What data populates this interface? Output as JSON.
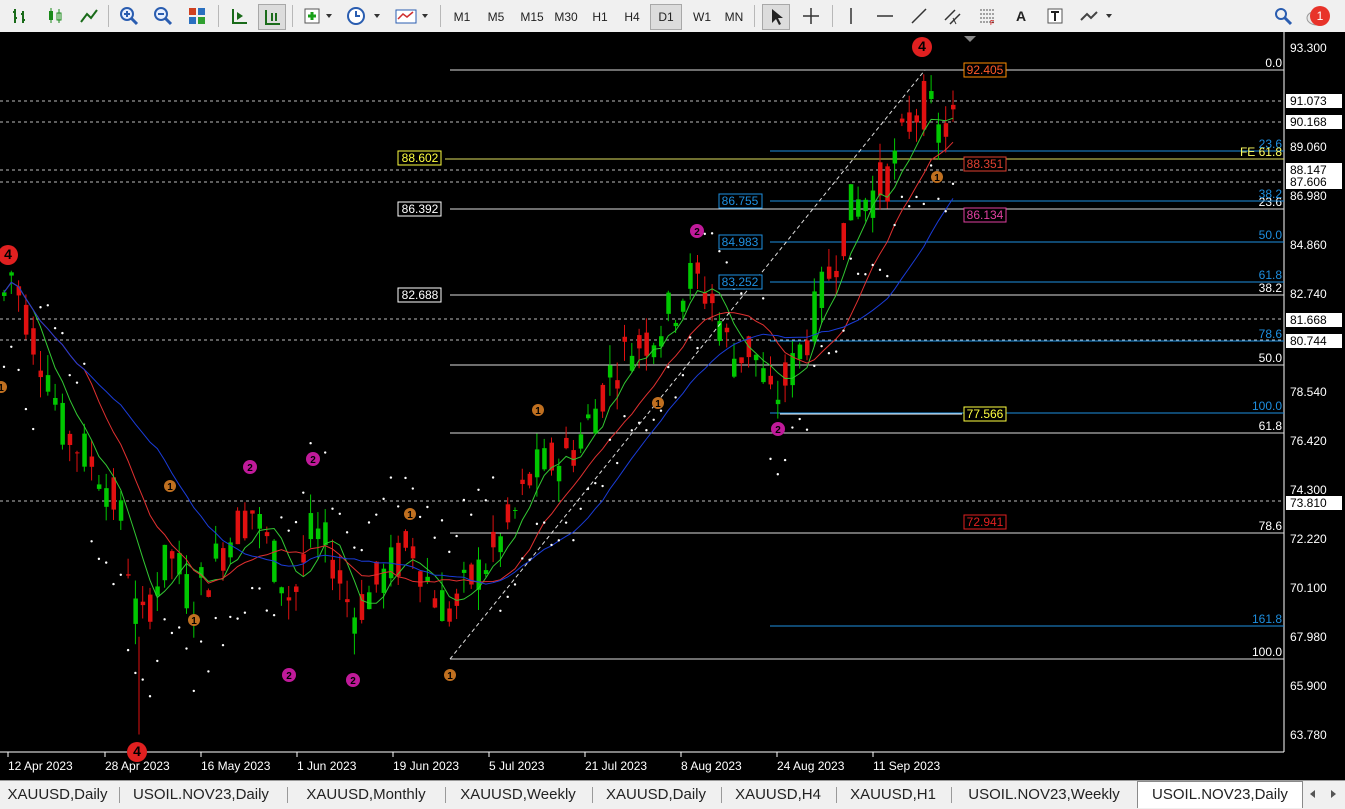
{
  "toolbar": {
    "timeframes": [
      "M1",
      "M5",
      "M15",
      "M30",
      "H1",
      "H4",
      "D1",
      "W1",
      "MN"
    ],
    "active_timeframe": "D1",
    "notification_count": "1",
    "text_tool_label": "A"
  },
  "chart": {
    "symbol": "USOIL.NOV23",
    "period": "Daily",
    "price_axis_labels": [
      "93.300",
      "92.405",
      "91.073",
      "90.168",
      "89.060",
      "88.147",
      "87.606",
      "86.980",
      "84.860",
      "82.740",
      "81.668",
      "80.744",
      "78.540",
      "76.420",
      "74.300",
      "73.810",
      "72.220",
      "70.100",
      "67.980",
      "65.900",
      "63.780"
    ],
    "date_axis_labels": [
      "12 Apr 2023",
      "28 Apr 2023",
      "16 May 2023",
      "1 Jun 2023",
      "19 Jun 2023",
      "5 Jul 2023",
      "21 Jul 2023",
      "8 Aug 2023",
      "24 Aug 2023",
      "11 Sep 2023"
    ],
    "left_level_tags": [
      "88.602",
      "86.392",
      "82.688"
    ],
    "right_level_tags": [
      "92.405",
      "88.351",
      "86.134",
      "72.941",
      "77.566"
    ],
    "blue_level_tags": [
      "86.755",
      "84.983",
      "83.252"
    ],
    "fibo_levels_white": [
      "0.0",
      "23.6",
      "38.2",
      "50.0",
      "61.8",
      "78.6",
      "100.0"
    ],
    "fibo_levels_blue": [
      "23.6",
      "38.2",
      "50.0",
      "61.8",
      "78.6",
      "100.0",
      "161.8"
    ],
    "fe_label": "FE 61.8",
    "wave_labels": [
      "4",
      "2",
      "2",
      "2",
      "2",
      "2",
      "2",
      "1",
      "1",
      "1",
      "1",
      "1",
      "1",
      "1",
      "4"
    ],
    "colors": {
      "bull": "#00c800",
      "bear": "#e01010",
      "ma_fast": "#32c832",
      "ma_mid": "#e03030",
      "ma_slow": "#1a3cd8",
      "fib_blue": "#1e8fe0",
      "tag_yellow": "#ffff40"
    }
  },
  "tabs": [
    {
      "label": "XAUUSD,Daily"
    },
    {
      "label": "USOIL.NOV23,Daily"
    },
    {
      "label": "XAUUSD,Monthly"
    },
    {
      "label": "XAUUSD,Weekly"
    },
    {
      "label": "XAUUSD,Daily"
    },
    {
      "label": "XAUUSD,H4"
    },
    {
      "label": "XAUUSD,H1"
    },
    {
      "label": "USOIL.NOV23,Weekly"
    },
    {
      "label": "USOIL.NOV23,Daily"
    }
  ],
  "active_tab": "USOIL.NOV23,Daily"
}
